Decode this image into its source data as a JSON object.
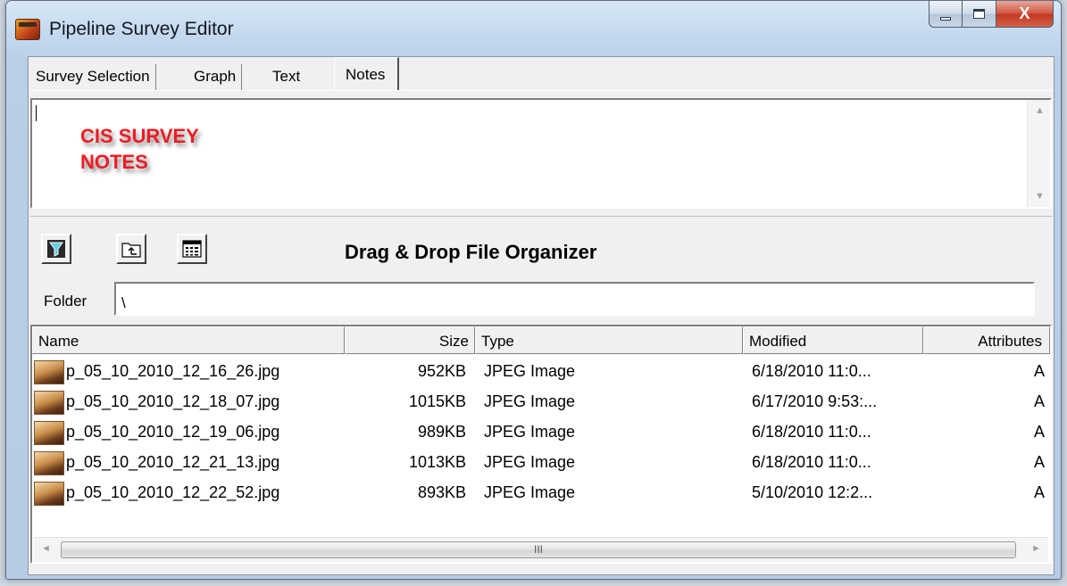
{
  "window": {
    "title": "Pipeline Survey Editor",
    "close_glyph": "X"
  },
  "tabs": [
    {
      "label": "Survey Selection",
      "active": false
    },
    {
      "label": "Graph",
      "active": false
    },
    {
      "label": "Text",
      "active": false
    },
    {
      "label": "Notes",
      "active": true
    }
  ],
  "notes": {
    "lines": [
      "CIS SURVEY",
      "NOTES"
    ],
    "text_color": "#ee1c24"
  },
  "organizer": {
    "title": "Drag & Drop File Organizer",
    "folder_label": "Folder",
    "folder_value": "\\",
    "tool_icons": [
      "filter-icon",
      "up-folder-icon",
      "details-view-icon"
    ]
  },
  "file_list": {
    "columns": [
      "Name",
      "Size",
      "Type",
      "Modified",
      "Attributes"
    ],
    "rows": [
      {
        "name": "p_05_10_2010_12_16_26.jpg",
        "size": "952KB",
        "type": "JPEG Image",
        "modified": "6/18/2010 11:0...",
        "attributes": "A"
      },
      {
        "name": "p_05_10_2010_12_18_07.jpg",
        "size": "1015KB",
        "type": "JPEG Image",
        "modified": "6/17/2010 9:53:...",
        "attributes": "A"
      },
      {
        "name": "p_05_10_2010_12_19_06.jpg",
        "size": "989KB",
        "type": "JPEG Image",
        "modified": "6/18/2010 11:0...",
        "attributes": "A"
      },
      {
        "name": "p_05_10_2010_12_21_13.jpg",
        "size": "1013KB",
        "type": "JPEG Image",
        "modified": "6/18/2010 11:0...",
        "attributes": "A"
      },
      {
        "name": "p_05_10_2010_12_22_52.jpg",
        "size": "893KB",
        "type": "JPEG Image",
        "modified": "5/10/2010 12:2...",
        "attributes": "A"
      }
    ],
    "scroll_grip": "III"
  }
}
